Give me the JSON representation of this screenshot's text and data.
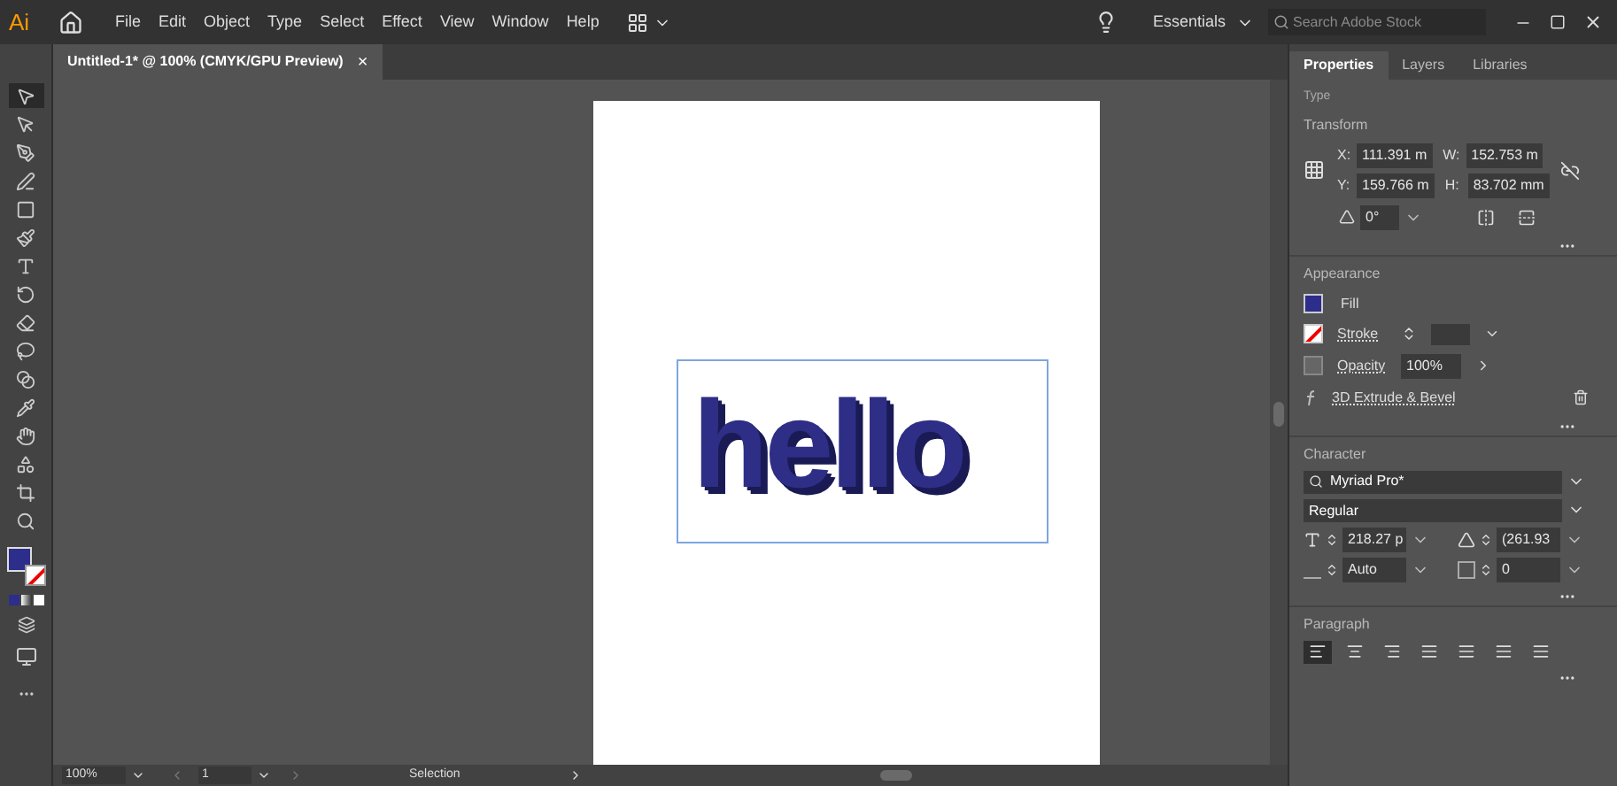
{
  "app": {
    "logo": "Ai"
  },
  "menu": [
    "File",
    "Edit",
    "Object",
    "Type",
    "Select",
    "Effect",
    "View",
    "Window",
    "Help"
  ],
  "workspace": "Essentials",
  "search": {
    "placeholder": "Search Adobe Stock"
  },
  "document_tab": {
    "title": "Untitled-1* @ 100% (CMYK/GPU Preview)",
    "close": "×"
  },
  "tools": [
    {
      "selected": true
    },
    {
      "selected": false
    },
    {
      "selected": false
    },
    {
      "selected": false
    },
    {
      "selected": false
    },
    {
      "selected": false
    },
    {
      "selected": false
    },
    {
      "selected": false
    },
    {
      "selected": false
    },
    {
      "selected": false
    },
    {
      "selected": false
    },
    {
      "selected": false
    },
    {
      "selected": false
    },
    {
      "selected": false
    },
    {
      "selected": false
    },
    {
      "selected": false
    }
  ],
  "canvas": {
    "text": "hello"
  },
  "panel": {
    "tabs": [
      {
        "label": "Properties",
        "selected": true
      },
      {
        "label": "Layers",
        "selected": false
      },
      {
        "label": "Libraries",
        "selected": false
      }
    ],
    "type_label": "Type",
    "transform": {
      "title": "Transform",
      "x_label": "X:",
      "x": "111.391 m",
      "w_label": "W:",
      "w": "152.753 m",
      "y_label": "Y:",
      "y": "159.766 m",
      "h_label": "H:",
      "h": "83.702 mm",
      "angle": "0°"
    },
    "appearance": {
      "title": "Appearance",
      "fill": "Fill",
      "stroke": "Stroke",
      "opacity_label": "Opacity",
      "opacity": "100%",
      "effect": "3D Extrude & Bevel"
    },
    "character": {
      "title": "Character",
      "font": "Myriad Pro*",
      "style": "Regular",
      "size": "218.27 p",
      "leading": "(261.93 ",
      "kerning": "Auto",
      "tracking": "0"
    },
    "paragraph": {
      "title": "Paragraph",
      "alignments": [
        {
          "selected": true
        },
        {
          "selected": false
        },
        {
          "selected": false
        },
        {
          "selected": false
        },
        {
          "selected": false
        },
        {
          "selected": false
        },
        {
          "selected": false
        }
      ]
    }
  },
  "status_bar": {
    "zoom": "100%",
    "page": "1",
    "tool": "Selection"
  }
}
